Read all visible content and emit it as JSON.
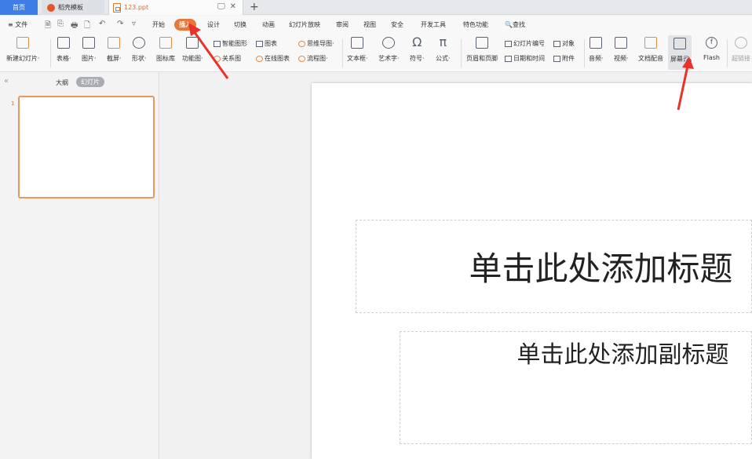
{
  "tabs": {
    "home": "首页",
    "templates": "稻壳模板",
    "document": "123.ppt"
  },
  "tab_controls": {
    "display": "🖵",
    "close": "✕",
    "new_tab": "+"
  },
  "menu": {
    "file": "≡ 文件",
    "quick_icons": [
      "🗎",
      "⎘",
      "🖶",
      "🗋",
      "↶",
      "↷",
      "▿"
    ],
    "items": [
      "开始",
      "插入",
      "设计",
      "切换",
      "动画",
      "幻灯片放映",
      "审阅",
      "视图",
      "安全",
      "开发工具",
      "特色功能",
      "🔍查找"
    ],
    "active_item": "插入"
  },
  "ribbon": {
    "new_slide": "新建幻灯片·",
    "table": "表格·",
    "picture": "图片·",
    "screenshot": "截屏·",
    "shapes": "形状·",
    "icons": "图标库",
    "function_chart": "功能图·",
    "smart_art": "智能图形",
    "chart": "图表",
    "mind_map": "思维导图·",
    "relationship": "关系图",
    "online_chart": "在线图表",
    "flowchart": "流程图·",
    "textbox": "文本框·",
    "art_text": "艺术字·",
    "symbol": "符号·",
    "formula": "公式·",
    "header_footer": "页眉和页脚",
    "slide_number": "幻灯片编号",
    "object": "对象",
    "date_time": "日期和时间",
    "attachment": "附件",
    "audio": "音频·",
    "video": "视频·",
    "doc_dub": "文档配音",
    "screen_record": "屏幕录",
    "flash": "Flash",
    "hyperlink": "超链接",
    "formula_glyph": "π",
    "symbol_glyph": "Ω",
    "flash_glyph": "f"
  },
  "panel": {
    "collapse": "«",
    "outline_tab": "大纲",
    "slides_tab": "幻灯片",
    "thumb_number": "1"
  },
  "slide": {
    "title_placeholder": "单击此处添加标题",
    "subtitle_placeholder": "单击此处添加副标题"
  },
  "colors": {
    "accent": "#E8773C",
    "home_tab": "#3E7DE6",
    "arrow": "#E8322A"
  }
}
